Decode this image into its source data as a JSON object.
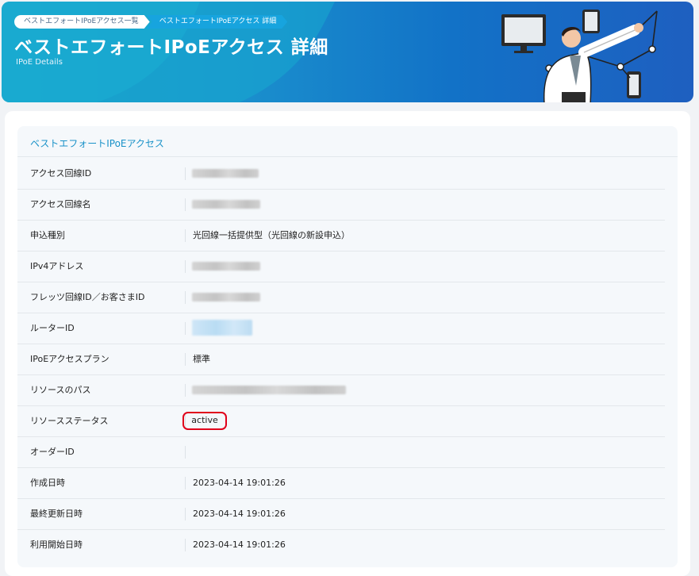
{
  "header": {
    "breadcrumb": [
      "ベストエフォートIPoEアクセス一覧",
      "ベストエフォートIPoEアクセス 詳細"
    ],
    "title": "ベストエフォートIPoEアクセス 詳細",
    "subtitle": "IPoE Details"
  },
  "panel": {
    "title": "ベストエフォートIPoEアクセス",
    "rows": [
      {
        "label": "アクセス回線ID",
        "value": ""
      },
      {
        "label": "アクセス回線名",
        "value": ""
      },
      {
        "label": "申込種別",
        "value": "光回線一括提供型（光回線の新設申込）"
      },
      {
        "label": "IPv4アドレス",
        "value": ""
      },
      {
        "label": "フレッツ回線ID／お客さまID",
        "value": ""
      },
      {
        "label": "ルーターID",
        "value": ""
      },
      {
        "label": "IPoEアクセスプラン",
        "value": "標準"
      },
      {
        "label": "リソースのパス",
        "value": ""
      },
      {
        "label": "リソースステータス",
        "value": "active"
      },
      {
        "label": "オーダーID",
        "value": ""
      },
      {
        "label": "作成日時",
        "value": "2023-04-14 19:01:26"
      },
      {
        "label": "最終更新日時",
        "value": "2023-04-14 19:01:26"
      },
      {
        "label": "利用開始日時",
        "value": "2023-04-14 19:01:26"
      }
    ]
  },
  "colors": {
    "accent": "#1a92c8",
    "highlight": "#e0001b"
  },
  "icons": [
    "person-with-devices-illustration"
  ]
}
